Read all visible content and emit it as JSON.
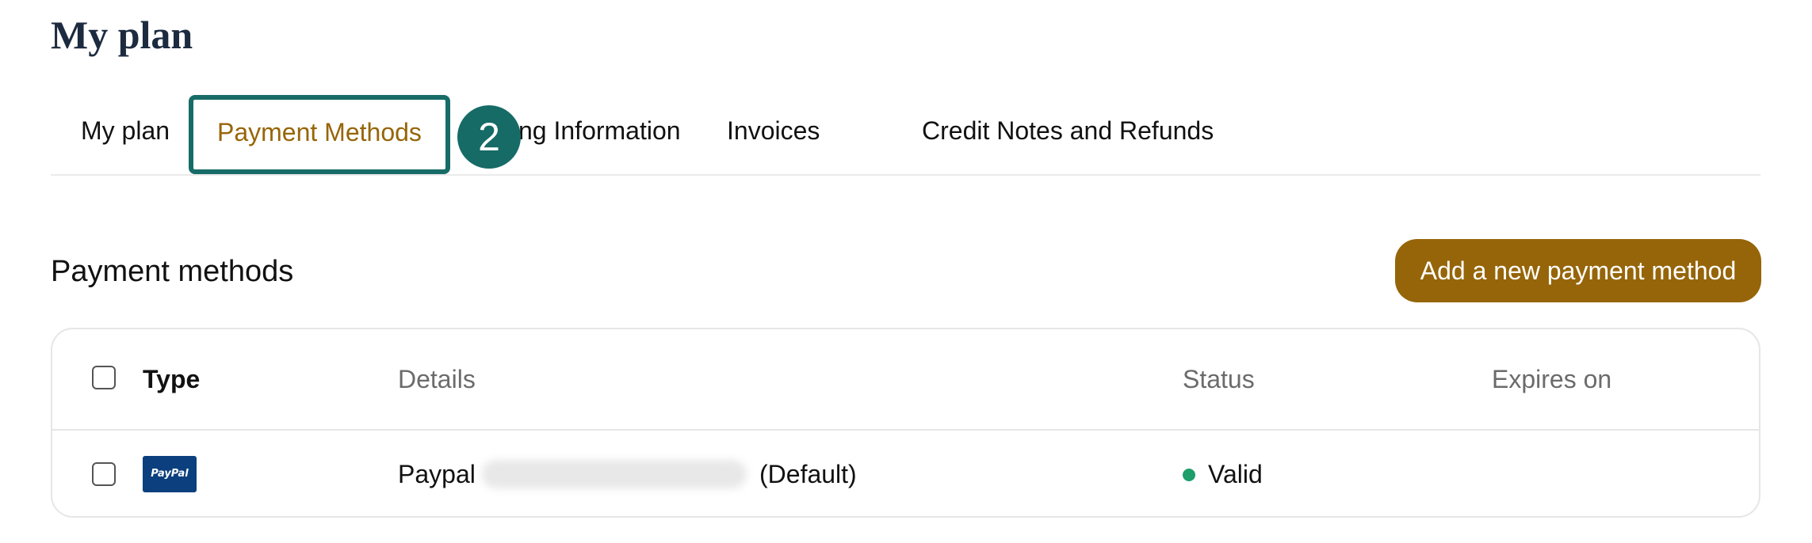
{
  "page": {
    "title": "My plan"
  },
  "tabs": [
    {
      "label": "My plan",
      "active": false
    },
    {
      "label": "Payment Methods",
      "active": true
    },
    {
      "label": "ng Information",
      "active": false
    },
    {
      "label": "Invoices",
      "active": false
    },
    {
      "label": "Credit Notes and Refunds",
      "active": false
    }
  ],
  "step_badge": "2",
  "section": {
    "title": "Payment methods",
    "add_button_label": "Add a new payment method"
  },
  "table": {
    "columns": {
      "type": "Type",
      "details": "Details",
      "status": "Status",
      "expires_on": "Expires on"
    },
    "rows": [
      {
        "type_logo": "PayPal",
        "details_prefix": "Paypal",
        "details_suffix": "(Default)",
        "status": "Valid",
        "expires_on": ""
      }
    ]
  },
  "colors": {
    "accent_brown": "#966509",
    "highlight_teal": "#176c68",
    "status_valid": "#1e9e6a",
    "paypal_blue": "#0b3f7e"
  },
  "icons": {
    "paypal_logo": "paypal-logo-icon",
    "status": "status-dot-icon"
  }
}
